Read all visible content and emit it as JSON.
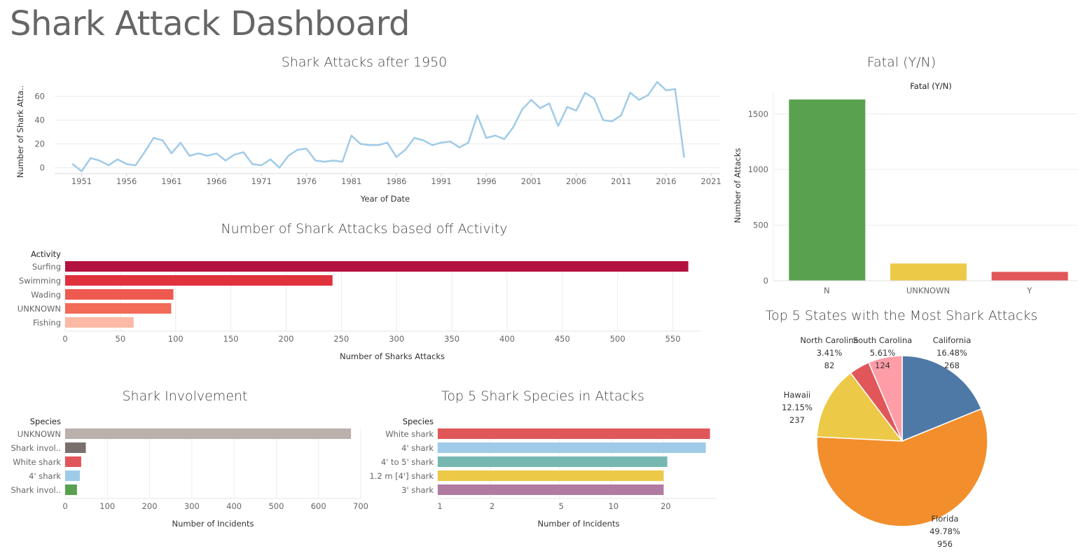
{
  "dashboard": {
    "title": "Shark Attack Dashboard"
  },
  "panels": {
    "line": {
      "title": "Shark Attacks after 1950"
    },
    "activity": {
      "title": "Number of Shark Attacks based off Activity"
    },
    "involvement": {
      "title": "Shark Involvement"
    },
    "species": {
      "title": "Top 5 Shark Species in Attacks"
    },
    "fatal": {
      "title": "Fatal (Y/N)"
    },
    "states": {
      "title": "Top 5 States with the Most Shark Attacks"
    }
  },
  "chart_data": [
    {
      "id": "line",
      "type": "line",
      "title": "Shark Attacks after 1950",
      "xlabel": "Year of Date",
      "ylabel": "Number of Shark Atta..",
      "color": "#a0cbe8",
      "xlim": [
        1948,
        2022
      ],
      "ylim": [
        -5,
        75
      ],
      "xticks": [
        1951,
        1956,
        1961,
        1966,
        1971,
        1976,
        1981,
        1986,
        1991,
        1996,
        2001,
        2006,
        2011,
        2016,
        2021
      ],
      "yticks": [
        0,
        20,
        40,
        60
      ],
      "x": [
        1950,
        1951,
        1952,
        1953,
        1954,
        1955,
        1956,
        1957,
        1958,
        1959,
        1960,
        1961,
        1962,
        1963,
        1964,
        1965,
        1966,
        1967,
        1968,
        1969,
        1970,
        1971,
        1972,
        1973,
        1974,
        1975,
        1976,
        1977,
        1978,
        1979,
        1980,
        1981,
        1982,
        1983,
        1984,
        1985,
        1986,
        1987,
        1988,
        1989,
        1990,
        1991,
        1992,
        1993,
        1994,
        1995,
        1996,
        1997,
        1998,
        1999,
        2000,
        2001,
        2002,
        2003,
        2004,
        2005,
        2006,
        2007,
        2008,
        2009,
        2010,
        2011,
        2012,
        2013,
        2014,
        2015,
        2016,
        2017,
        2018
      ],
      "y": [
        3,
        -3,
        8,
        6,
        2,
        7,
        3,
        2,
        13,
        25,
        23,
        12,
        21,
        10,
        12,
        10,
        12,
        6,
        11,
        13,
        3,
        2,
        7,
        0,
        10,
        15,
        16,
        6,
        5,
        6,
        5,
        27,
        20,
        19,
        19,
        21,
        9,
        15,
        25,
        23,
        19,
        21,
        22,
        17,
        21,
        44,
        25,
        27,
        24,
        34,
        49,
        57,
        50,
        54,
        35,
        51,
        48,
        63,
        58,
        40,
        39,
        44,
        63,
        57,
        61,
        72,
        65,
        66,
        9
      ]
    },
    {
      "id": "activity",
      "type": "bar",
      "orientation": "horizontal",
      "title": "Number of Shark Attacks based off Activity",
      "category_header": "Activity",
      "xlabel": "Number of Sharks Attacks",
      "xlim": [
        0,
        575
      ],
      "xticks": [
        0,
        50,
        100,
        150,
        200,
        250,
        300,
        350,
        400,
        450,
        500,
        550
      ],
      "categories": [
        "Surfing",
        "Swimming",
        "Wading",
        "UNKNOWN",
        "Fishing"
      ],
      "values": [
        564,
        242,
        98,
        96,
        62
      ],
      "colors": [
        "#b4123e",
        "#e0323c",
        "#ee5a4f",
        "#f26a58",
        "#fbb9a6"
      ]
    },
    {
      "id": "involvement",
      "type": "bar",
      "orientation": "horizontal",
      "title": "Shark Involvement",
      "category_header": "Species",
      "xlabel": "Number of Incidents",
      "xlim": [
        0,
        700
      ],
      "xticks": [
        0,
        100,
        200,
        300,
        400,
        500,
        600,
        700
      ],
      "categories": [
        "UNKNOWN",
        "Shark invol..",
        "White shark",
        "4' shark",
        "Shark invol.."
      ],
      "values": [
        677,
        49,
        38,
        35,
        28
      ],
      "colors": [
        "#bab0ac",
        "#79706e",
        "#e15759",
        "#a0cbe8",
        "#59a14f"
      ]
    },
    {
      "id": "species",
      "type": "bar",
      "orientation": "horizontal",
      "scale": "log",
      "title": "Top 5 Shark Species in Attacks",
      "category_header": "Species",
      "xlabel": "Number of Incidents",
      "xlim": [
        1,
        40
      ],
      "xticks": [
        1,
        2,
        5,
        10,
        20
      ],
      "categories": [
        "White shark",
        "4' shark",
        "4' to 5' shark",
        "1.2 m [4'] shark",
        "3' shark"
      ],
      "values": [
        37,
        35,
        21,
        20,
        20
      ],
      "colors": [
        "#e15759",
        "#a0cbe8",
        "#76b7b2",
        "#edc948",
        "#b07aa1"
      ]
    },
    {
      "id": "fatal",
      "type": "bar",
      "title": "Fatal (Y/N)",
      "subtitle": "Fatal (Y/N)",
      "ylabel": "Number of Attacks",
      "ylim": [
        0,
        1700
      ],
      "yticks": [
        0,
        500,
        1000,
        1500
      ],
      "categories": [
        "N",
        "UNKNOWN",
        "Y"
      ],
      "values": [
        1630,
        155,
        80
      ],
      "colors": [
        "#59a14f",
        "#edc948",
        "#e15759"
      ]
    },
    {
      "id": "states",
      "type": "pie",
      "title": "Top 5 States with the Most Shark Attacks",
      "slices": [
        {
          "label": "California",
          "pct": "16.48%",
          "count": "268",
          "value": 16.48,
          "color": "#4e79a7"
        },
        {
          "label": "Florida",
          "pct": "49.78%",
          "count": "956",
          "value": 49.78,
          "color": "#f28e2b"
        },
        {
          "label": "Hawaii",
          "pct": "12.15%",
          "count": "237",
          "value": 12.15,
          "color": "#edc948"
        },
        {
          "label": "North Carolina",
          "pct": "3.41%",
          "count": "82",
          "value": 3.41,
          "color": "#e15759"
        },
        {
          "label": "South Carolina",
          "pct": "5.61%",
          "count": "124",
          "value": 5.61,
          "color": "#ff9da7"
        }
      ]
    }
  ]
}
